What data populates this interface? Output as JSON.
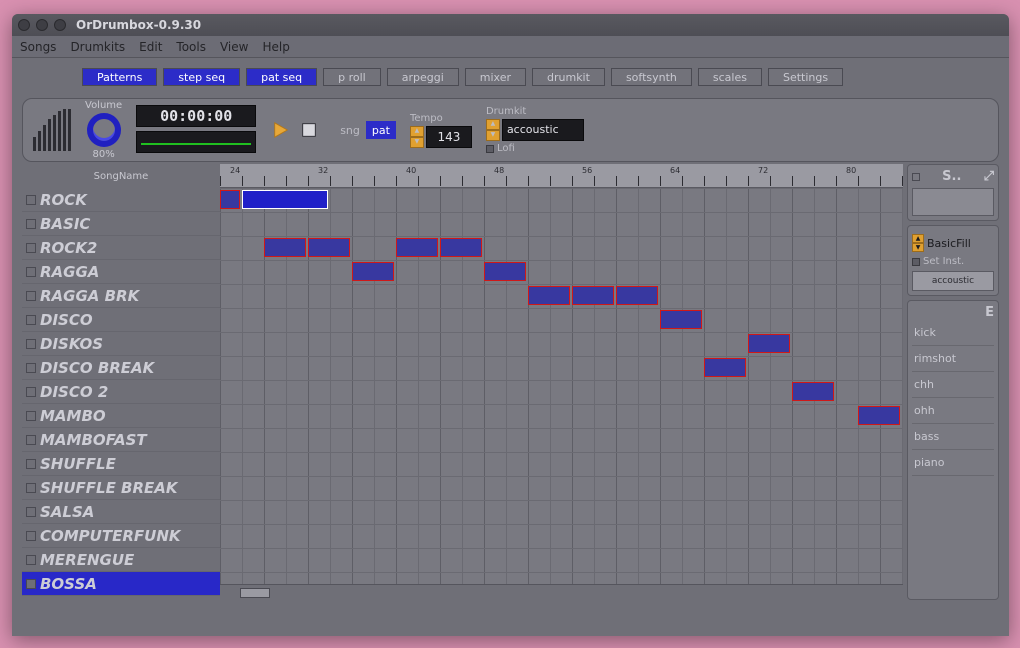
{
  "window": {
    "title": "OrDrumbox-0.9.30"
  },
  "menu": [
    "Songs",
    "Drumkits",
    "Edit",
    "Tools",
    "View",
    "Help"
  ],
  "tabs": [
    {
      "label": "Patterns",
      "active": true
    },
    {
      "label": "step seq",
      "active": true
    },
    {
      "label": "pat seq",
      "active": true
    },
    {
      "label": "p roll",
      "active": false
    },
    {
      "label": "arpeggi",
      "active": false
    },
    {
      "label": "mixer",
      "active": false
    },
    {
      "label": "drumkit",
      "active": false
    },
    {
      "label": "softsynth",
      "active": false
    },
    {
      "label": "scales",
      "active": false
    },
    {
      "label": "Settings",
      "active": false
    }
  ],
  "transport": {
    "volume_label": "Volume",
    "volume_value": "80%",
    "time": "00:00:00",
    "sng": "sng",
    "pat": "pat",
    "tempo_label": "Tempo",
    "tempo_value": "143",
    "drumkit_label": "Drumkit",
    "drumkit_value": "accoustic",
    "lofi_label": "Lofi"
  },
  "song": {
    "header": "SongName",
    "ruler_labels": [
      "24",
      "32",
      "40",
      "48",
      "56",
      "64",
      "72",
      "80"
    ],
    "tracks": [
      {
        "name": "ROCK",
        "selected": false
      },
      {
        "name": "BASIC",
        "selected": false
      },
      {
        "name": "ROCK2",
        "selected": false
      },
      {
        "name": "RAGGA",
        "selected": false
      },
      {
        "name": "RAGGA BRK",
        "selected": false
      },
      {
        "name": "DISCO",
        "selected": false
      },
      {
        "name": "DISKOS",
        "selected": false
      },
      {
        "name": "DISCO BREAK",
        "selected": false
      },
      {
        "name": "DISCO 2",
        "selected": false
      },
      {
        "name": "MAMBO",
        "selected": false
      },
      {
        "name": "MAMBOFAST",
        "selected": false
      },
      {
        "name": "SHUFFLE",
        "selected": false
      },
      {
        "name": "SHUFFLE BREAK",
        "selected": false
      },
      {
        "name": "SALSA",
        "selected": false
      },
      {
        "name": "COMPUTERFUNK",
        "selected": false
      },
      {
        "name": "MERENGUE",
        "selected": false
      },
      {
        "name": "BOSSA",
        "selected": true
      }
    ],
    "blocks": [
      {
        "row": 0,
        "col": 0,
        "w": 1,
        "wide": false
      },
      {
        "row": 0,
        "col": 1,
        "w": 4,
        "wide": true
      },
      {
        "row": 2,
        "col": 2,
        "w": 2
      },
      {
        "row": 2,
        "col": 4,
        "w": 2
      },
      {
        "row": 2,
        "col": 8,
        "w": 2
      },
      {
        "row": 2,
        "col": 10,
        "w": 2
      },
      {
        "row": 3,
        "col": 6,
        "w": 2
      },
      {
        "row": 3,
        "col": 12,
        "w": 2
      },
      {
        "row": 4,
        "col": 14,
        "w": 2
      },
      {
        "row": 4,
        "col": 16,
        "w": 2
      },
      {
        "row": 4,
        "col": 18,
        "w": 2
      },
      {
        "row": 5,
        "col": 20,
        "w": 2
      },
      {
        "row": 6,
        "col": 24,
        "w": 2
      },
      {
        "row": 7,
        "col": 22,
        "w": 2
      },
      {
        "row": 8,
        "col": 26,
        "w": 2
      },
      {
        "row": 9,
        "col": 29,
        "w": 2
      }
    ]
  },
  "side": {
    "panel_s": "S..",
    "basicfill": "BasicFill",
    "setinst": "Set Inst.",
    "accoustic": "accoustic",
    "e": "E",
    "instruments": [
      "kick",
      "rimshot",
      "chh",
      "ohh",
      "bass",
      "piano"
    ]
  }
}
